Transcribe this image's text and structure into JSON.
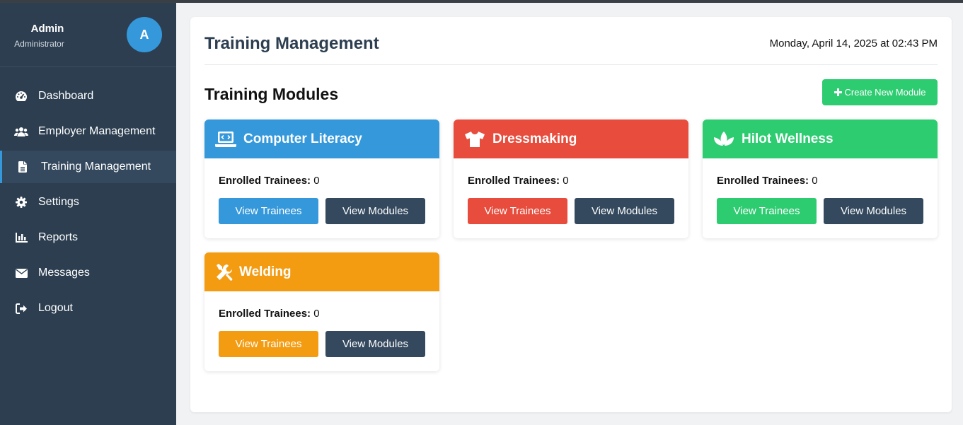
{
  "user": {
    "name": "Admin",
    "role": "Administrator",
    "avatar_initial": "A"
  },
  "nav": [
    {
      "label": "Dashboard",
      "icon": "dashboard-gauge-icon",
      "active": false
    },
    {
      "label": "Employer Management",
      "icon": "users-icon",
      "active": false
    },
    {
      "label": "Training Management",
      "icon": "document-icon",
      "active": true
    },
    {
      "label": "Settings",
      "icon": "gear-icon",
      "active": false
    },
    {
      "label": "Reports",
      "icon": "bar-chart-icon",
      "active": false
    },
    {
      "label": "Messages",
      "icon": "envelope-icon",
      "active": false
    },
    {
      "label": "Logout",
      "icon": "sign-out-icon",
      "active": false
    }
  ],
  "header": {
    "title": "Training Management",
    "datetime": "Monday, April 14, 2025 at 02:43 PM"
  },
  "modules": {
    "title": "Training Modules",
    "create_label": "Create New Module",
    "enrolled_label": "Enrolled Trainees:",
    "view_trainees_label": "View Trainees",
    "view_modules_label": "View Modules",
    "items": [
      {
        "name": "Computer Literacy",
        "enrolled": "0",
        "color": "#3498db",
        "icon": "laptop-code-icon"
      },
      {
        "name": "Dressmaking",
        "enrolled": "0",
        "color": "#e74c3c",
        "icon": "shirt-icon"
      },
      {
        "name": "Hilot Wellness",
        "enrolled": "0",
        "color": "#2ecc71",
        "icon": "spa-icon"
      },
      {
        "name": "Welding",
        "enrolled": "0",
        "color": "#f39c12",
        "icon": "tools-icon"
      }
    ]
  },
  "colors": {
    "sidebar": "#2c3e50",
    "active_item": "#34495e",
    "accent": "#3498db",
    "dark_button": "#34495e"
  }
}
